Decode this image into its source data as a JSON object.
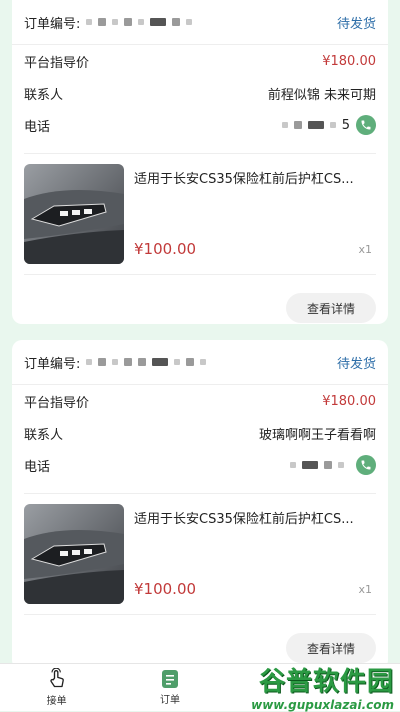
{
  "orders": [
    {
      "order_label": "订单编号:",
      "status": "待发货",
      "guide_price_label": "平台指导价",
      "guide_price": "¥180.00",
      "contact_label": "联系人",
      "contact_name": "前程似锦 未来可期",
      "phone_label": "电话",
      "phone_suffix": "5",
      "product_name": "适用于长安CS35保险杠前后护杠CS...",
      "product_price": "¥100.00",
      "quantity": "x1",
      "detail_button": "查看详情"
    },
    {
      "order_label": "订单编号:",
      "status": "待发货",
      "guide_price_label": "平台指导价",
      "guide_price": "¥180.00",
      "contact_label": "联系人",
      "contact_name": "玻璃啊啊王子看看啊",
      "phone_label": "电话",
      "phone_suffix": "",
      "product_name": "适用于长安CS35保险杠前后护杠CS...",
      "product_price": "¥100.00",
      "quantity": "x1",
      "detail_button": "查看详情"
    }
  ],
  "tabbar": {
    "items": [
      {
        "label": "接单",
        "icon": "tap-hand-icon"
      },
      {
        "label": "订单",
        "icon": "order-list-icon"
      }
    ]
  },
  "watermark": {
    "main": "谷普软件园",
    "sub": "www.gupuxlazai.com"
  },
  "colors": {
    "background": "#e9f7ee",
    "status_blue": "#2d6ea8",
    "price_red": "#c23a3a",
    "accent_green": "#5fae7b"
  }
}
